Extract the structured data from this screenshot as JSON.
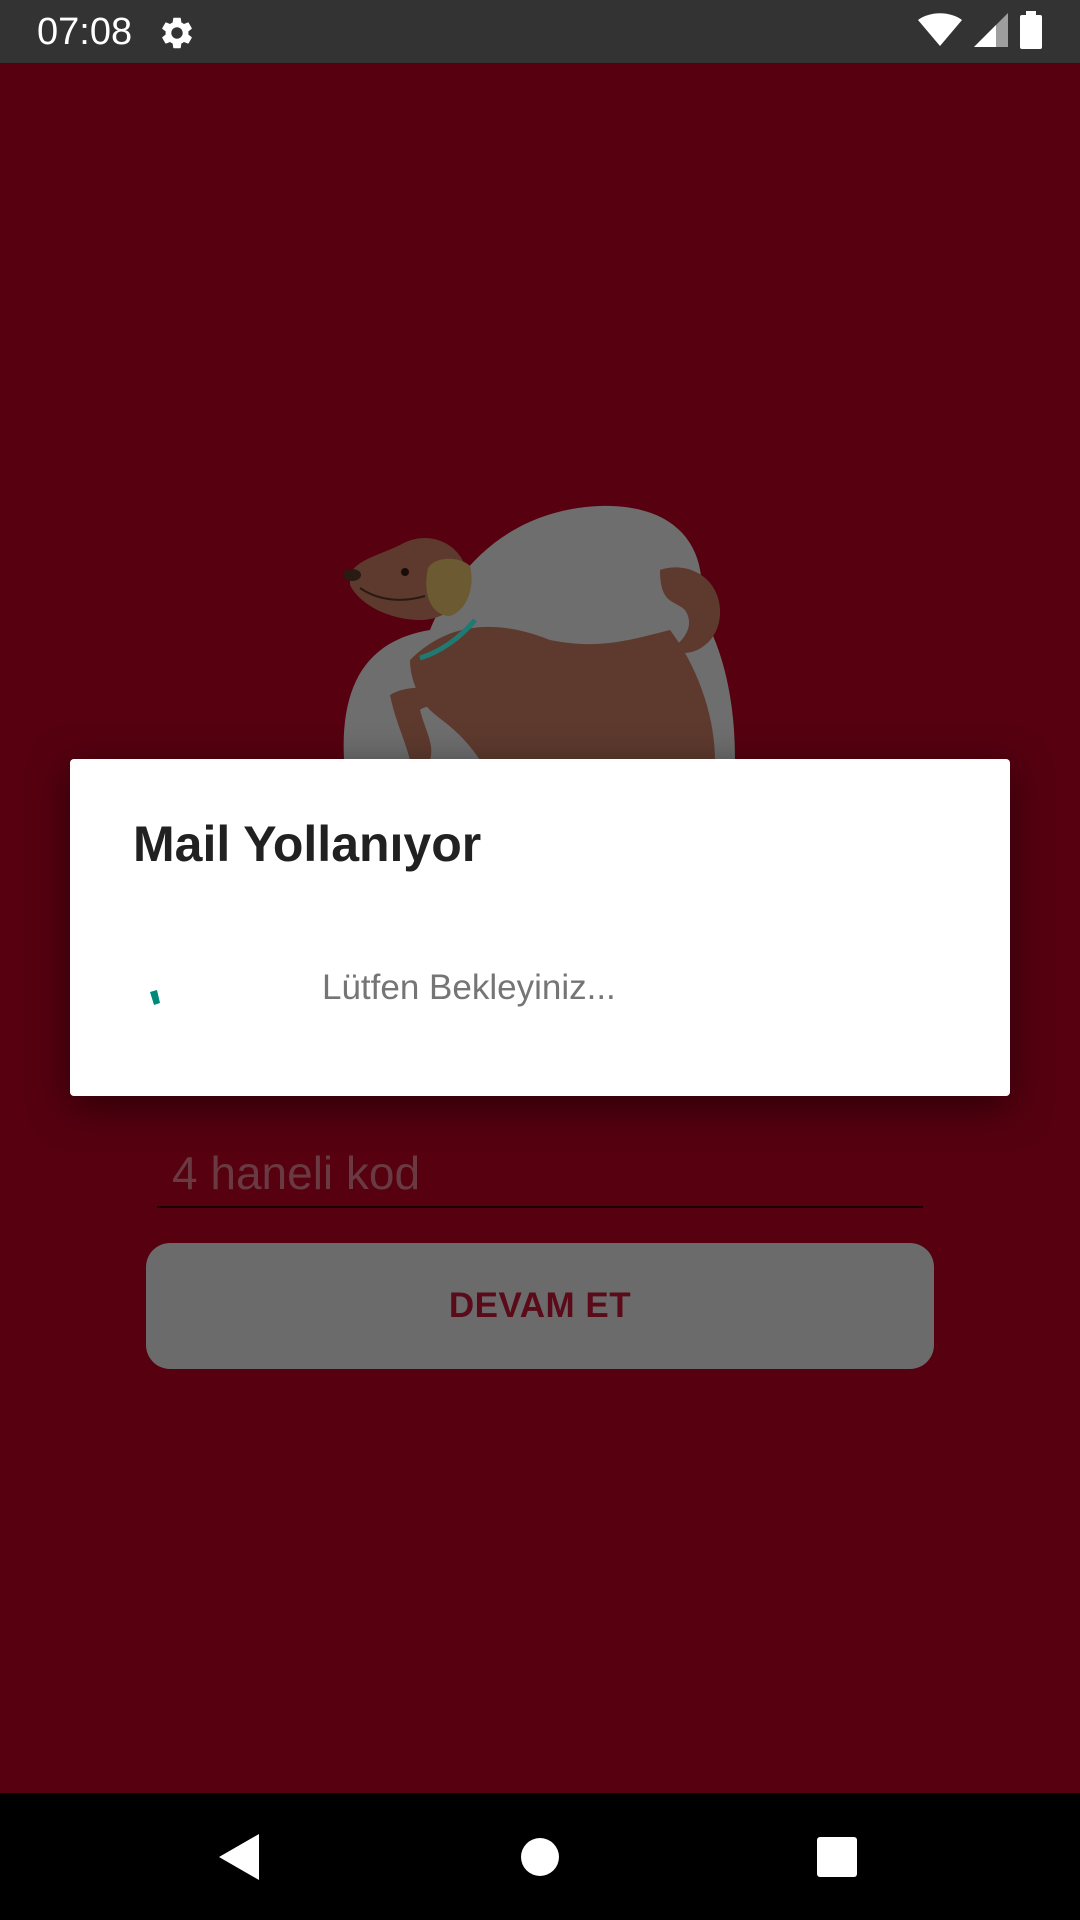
{
  "status_bar": {
    "time": "07:08",
    "icons": [
      "gear-icon",
      "wifi-icon",
      "signal-icon",
      "battery-icon"
    ]
  },
  "main": {
    "code_input": {
      "value": "",
      "placeholder": "4 haneli kod"
    },
    "continue_button": {
      "label": "DEVAM ET"
    }
  },
  "dialog": {
    "title": "Mail Yollanıyor",
    "message": "Lütfen Bekleyiniz..."
  },
  "nav_bar": {
    "icons": [
      "back-icon",
      "home-icon",
      "recents-icon"
    ]
  },
  "colors": {
    "background": "#560010",
    "status_bar": "#333333",
    "spinner_accent": "#00897b",
    "button_background": "#6b6b6b",
    "button_text": "#5a0a18"
  }
}
